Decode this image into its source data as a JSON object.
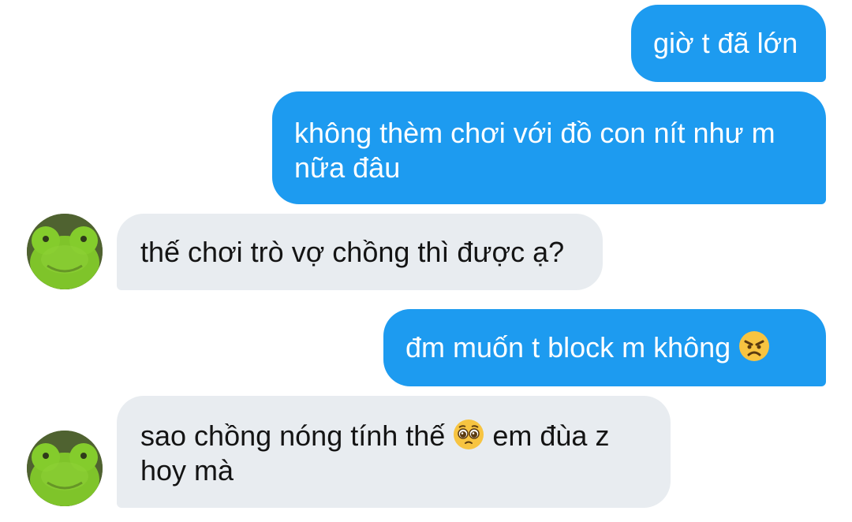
{
  "messages": [
    {
      "id": "m1",
      "direction": "outgoing",
      "text": "giờ t đã lớn"
    },
    {
      "id": "m2",
      "direction": "outgoing",
      "text": "không thèm chơi với đồ con nít như m nữa đâu"
    },
    {
      "id": "m3",
      "direction": "incoming",
      "text": "thế chơi trò vợ chồng thì được ạ?"
    },
    {
      "id": "m4",
      "direction": "outgoing",
      "text": "đm muốn t block m không",
      "trailing_emoji": "angry-face-icon"
    },
    {
      "id": "m5",
      "direction": "incoming",
      "text_before": "sao chồng nóng tính thế",
      "inline_emoji": "pleading-face-icon",
      "text_after": "em đùa z hoy mà"
    }
  ],
  "colors": {
    "outgoing_bubble": "#1d9bf0",
    "incoming_bubble": "#e8ecf0",
    "outgoing_text": "#ffffff",
    "incoming_text": "#141414"
  },
  "avatar": {
    "icon": "green-frog-plush-avatar"
  }
}
